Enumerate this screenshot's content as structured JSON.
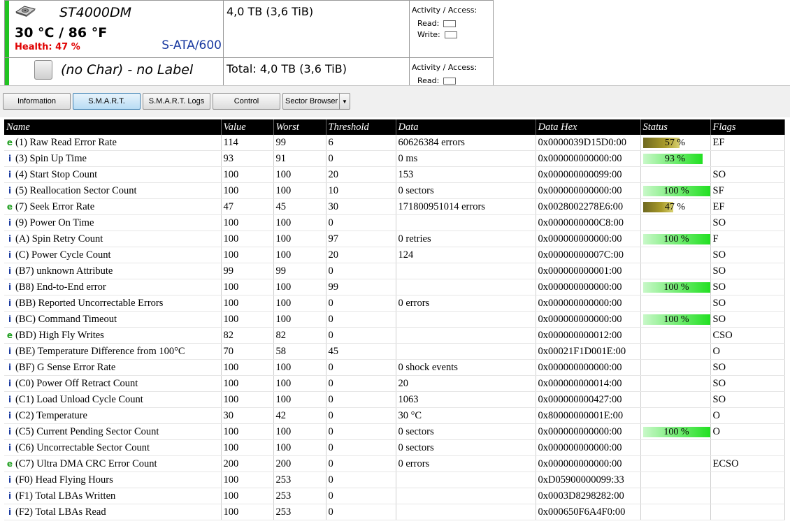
{
  "drive": {
    "model": "ST4000DM",
    "temperature": "30 °C / 86 °F",
    "health": "Health: 47 %",
    "interface": "S-ATA/600",
    "capacity": "4,0 TB (3,6 TiB)",
    "activity_title": "Activity / Access:",
    "read_label": "Read:",
    "write_label": "Write:",
    "icon": "hard-drive-icon"
  },
  "partition": {
    "label": "(no Char) - no Label",
    "total": "Total: 4,0 TB (3,6 TiB)",
    "activity_title": "Activity / Access:",
    "read_label": "Read:",
    "icon": "partition-icon"
  },
  "tabs": [
    {
      "label": "Information",
      "active": false
    },
    {
      "label": "S.M.A.R.T.",
      "active": true
    },
    {
      "label": "S.M.A.R.T. Logs",
      "active": false
    },
    {
      "label": "Control",
      "active": false
    },
    {
      "label": "Sector Browser",
      "active": false,
      "dropdown": true
    }
  ],
  "colors": {
    "status_good": "#22e022",
    "status_warn": "#a89a2a",
    "drive_bar": "#22c322",
    "health_text": "#e00000"
  },
  "table": {
    "columns": [
      "Name",
      "Value",
      "Worst",
      "Threshold",
      "Data",
      "Data Hex",
      "Status",
      "Flags"
    ],
    "rows": [
      {
        "t": "e",
        "name": "(1) Raw Read Error Rate",
        "value": "114",
        "worst": "99",
        "thr": "6",
        "data": "60626384 errors",
        "hex": "0x0000039D15D0:00",
        "status": "57 %",
        "pct": 57,
        "kind": "warn",
        "flags": "EF"
      },
      {
        "t": "i",
        "name": "(3) Spin Up Time",
        "value": "93",
        "worst": "91",
        "thr": "0",
        "data": "0 ms",
        "hex": "0x000000000000:00",
        "status": "93 %",
        "pct": 93,
        "kind": "good",
        "flags": ""
      },
      {
        "t": "i",
        "name": "(4) Start Stop Count",
        "value": "100",
        "worst": "100",
        "thr": "20",
        "data": "153",
        "hex": "0x000000000099:00",
        "status": "",
        "flags": "SO"
      },
      {
        "t": "i",
        "name": "(5) Reallocation Sector Count",
        "value": "100",
        "worst": "100",
        "thr": "10",
        "data": "0 sectors",
        "hex": "0x000000000000:00",
        "status": "100 %",
        "pct": 100,
        "kind": "good",
        "flags": "SF"
      },
      {
        "t": "e",
        "name": "(7) Seek Error Rate",
        "value": "47",
        "worst": "45",
        "thr": "30",
        "data": "171800951014 errors",
        "hex": "0x0028002278E6:00",
        "status": "47 %",
        "pct": 47,
        "kind": "warn",
        "flags": "EF"
      },
      {
        "t": "i",
        "name": "(9) Power On Time",
        "value": "100",
        "worst": "100",
        "thr": "0",
        "data": "",
        "hex": "0x0000000000C8:00",
        "status": "",
        "flags": "SO"
      },
      {
        "t": "i",
        "name": "(A) Spin Retry Count",
        "value": "100",
        "worst": "100",
        "thr": "97",
        "data": "0 retries",
        "hex": "0x000000000000:00",
        "status": "100 %",
        "pct": 100,
        "kind": "good",
        "flags": "F"
      },
      {
        "t": "i",
        "name": "(C) Power Cycle Count",
        "value": "100",
        "worst": "100",
        "thr": "20",
        "data": "124",
        "hex": "0x00000000007C:00",
        "status": "",
        "flags": "SO"
      },
      {
        "t": "i",
        "name": "(B7) unknown Attribute",
        "value": "99",
        "worst": "99",
        "thr": "0",
        "data": "",
        "hex": "0x000000000001:00",
        "status": "",
        "flags": "SO"
      },
      {
        "t": "i",
        "name": "(B8) End-to-End error",
        "value": "100",
        "worst": "100",
        "thr": "99",
        "data": "",
        "hex": "0x000000000000:00",
        "status": "100 %",
        "pct": 100,
        "kind": "good",
        "flags": "SO"
      },
      {
        "t": "i",
        "name": "(BB) Reported Uncorrectable Errors",
        "value": "100",
        "worst": "100",
        "thr": "0",
        "data": "0 errors",
        "hex": "0x000000000000:00",
        "status": "",
        "flags": "SO"
      },
      {
        "t": "i",
        "name": "(BC) Command Timeout",
        "value": "100",
        "worst": "100",
        "thr": "0",
        "data": "",
        "hex": "0x000000000000:00",
        "status": "100 %",
        "pct": 100,
        "kind": "good",
        "flags": "SO"
      },
      {
        "t": "e",
        "name": "(BD) High Fly Writes",
        "value": "82",
        "worst": "82",
        "thr": "0",
        "data": "",
        "hex": "0x000000000012:00",
        "status": "",
        "flags": "CSO"
      },
      {
        "t": "i",
        "name": "(BE) Temperature Difference from 100°C",
        "value": "70",
        "worst": "58",
        "thr": "45",
        "data": "",
        "hex": "0x00021F1D001E:00",
        "status": "",
        "flags": "O"
      },
      {
        "t": "i",
        "name": "(BF) G Sense Error Rate",
        "value": "100",
        "worst": "100",
        "thr": "0",
        "data": "0 shock events",
        "hex": "0x000000000000:00",
        "status": "",
        "flags": "SO"
      },
      {
        "t": "i",
        "name": "(C0) Power Off Retract Count",
        "value": "100",
        "worst": "100",
        "thr": "0",
        "data": "20",
        "hex": "0x000000000014:00",
        "status": "",
        "flags": "SO"
      },
      {
        "t": "i",
        "name": "(C1) Load Unload Cycle Count",
        "value": "100",
        "worst": "100",
        "thr": "0",
        "data": "1063",
        "hex": "0x000000000427:00",
        "status": "",
        "flags": "SO"
      },
      {
        "t": "i",
        "name": "(C2) Temperature",
        "value": "30",
        "worst": "42",
        "thr": "0",
        "data": "30 °C",
        "hex": "0x80000000001E:00",
        "status": "",
        "flags": "O"
      },
      {
        "t": "i",
        "name": "(C5) Current Pending Sector Count",
        "value": "100",
        "worst": "100",
        "thr": "0",
        "data": "0 sectors",
        "hex": "0x000000000000:00",
        "status": "100 %",
        "pct": 100,
        "kind": "good",
        "flags": "O"
      },
      {
        "t": "i",
        "name": "(C6) Uncorrectable Sector Count",
        "value": "100",
        "worst": "100",
        "thr": "0",
        "data": "0 sectors",
        "hex": "0x000000000000:00",
        "status": "",
        "flags": ""
      },
      {
        "t": "e",
        "name": "(C7) Ultra DMA CRC Error Count",
        "value": "200",
        "worst": "200",
        "thr": "0",
        "data": "0 errors",
        "hex": "0x000000000000:00",
        "status": "",
        "flags": "ECSO"
      },
      {
        "t": "i",
        "name": "(F0) Head Flying Hours",
        "value": "100",
        "worst": "253",
        "thr": "0",
        "data": "",
        "hex": "0xD05900000099:33",
        "status": "",
        "flags": ""
      },
      {
        "t": "i",
        "name": "(F1) Total LBAs Written",
        "value": "100",
        "worst": "253",
        "thr": "0",
        "data": "",
        "hex": "0x0003D8298282:00",
        "status": "",
        "flags": ""
      },
      {
        "t": "i",
        "name": "(F2) Total LBAs Read",
        "value": "100",
        "worst": "253",
        "thr": "0",
        "data": "",
        "hex": "0x000650F6A4F0:00",
        "status": "",
        "flags": ""
      }
    ]
  }
}
